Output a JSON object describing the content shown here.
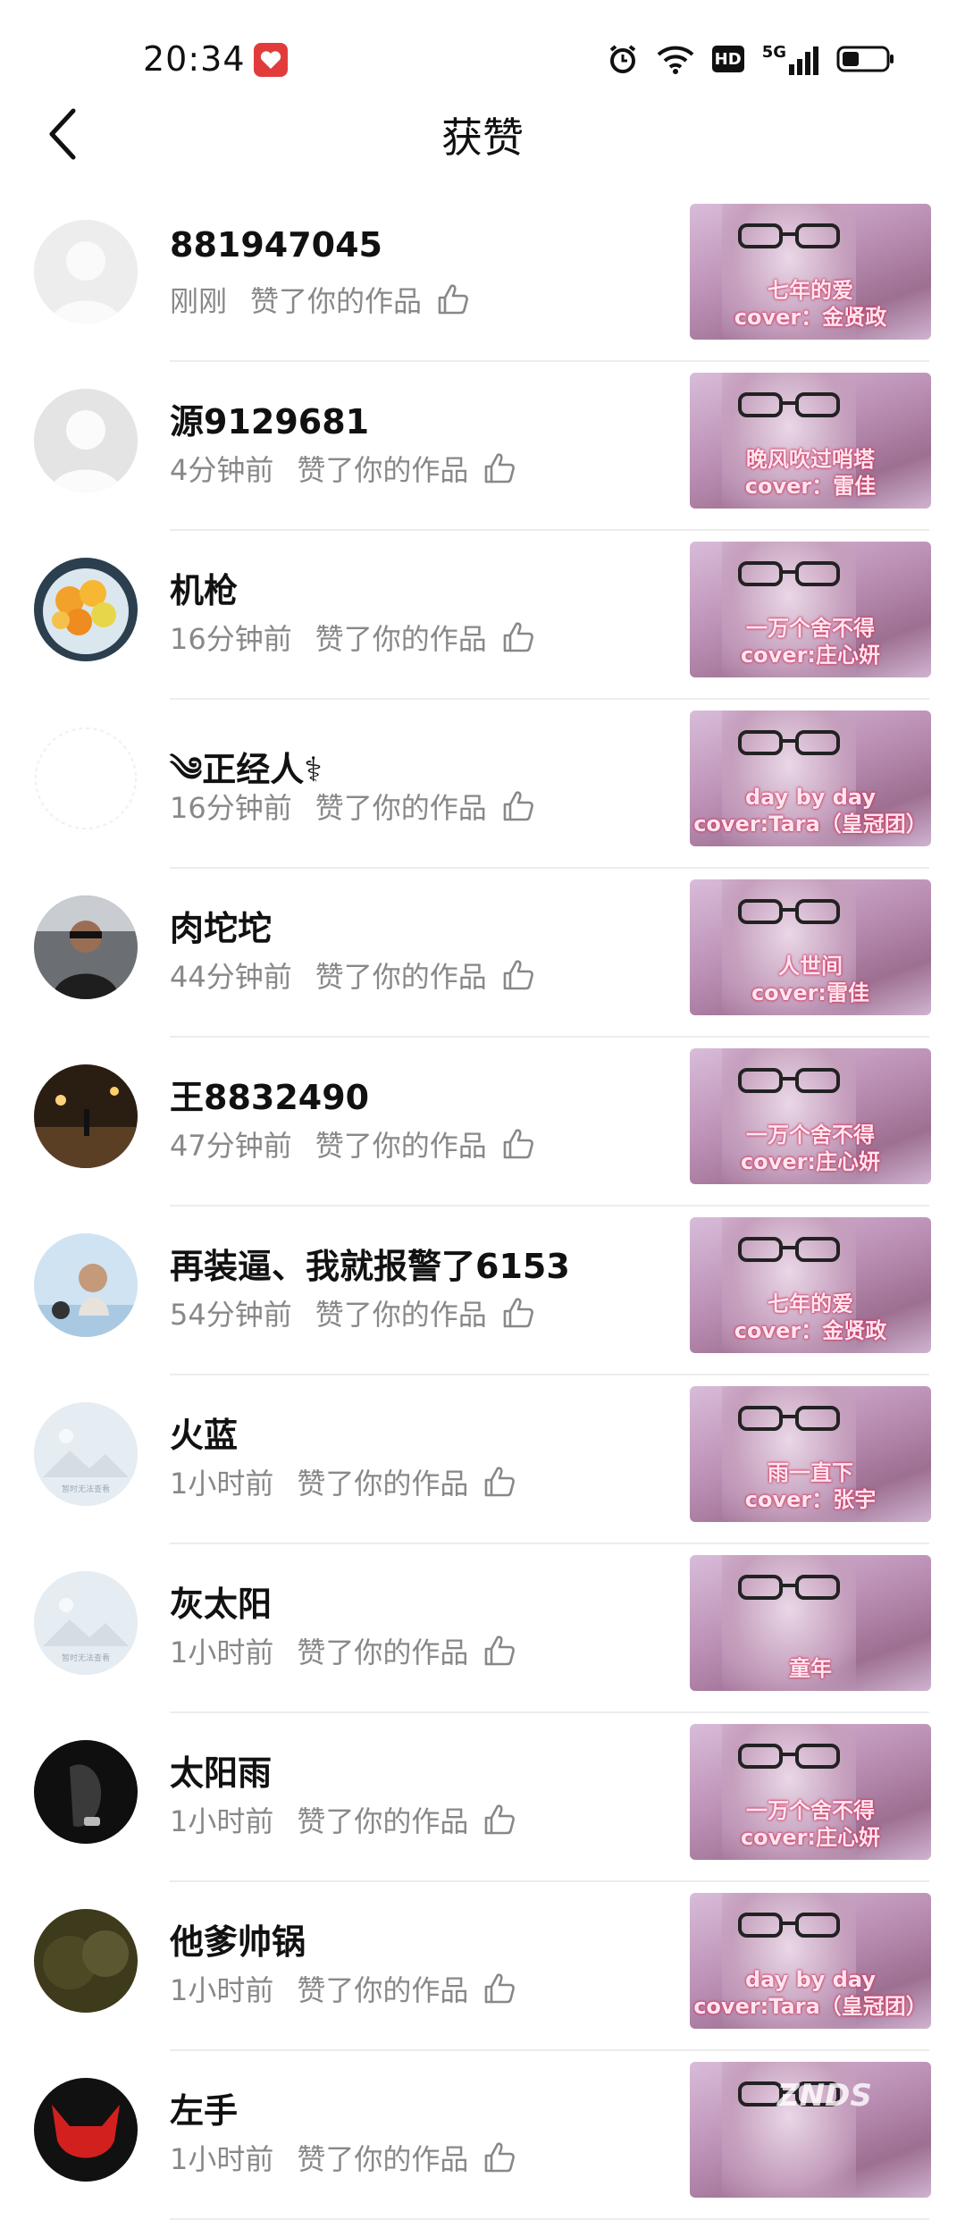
{
  "status_bar": {
    "time": "20:34",
    "icons": [
      "alarm-icon",
      "wifi-icon",
      "hd-icon",
      "5g-signal-icon",
      "battery-icon"
    ],
    "hd_label": "HD",
    "network_label": "5G"
  },
  "header": {
    "title": "获赞",
    "back_icon": "chevron-left-icon"
  },
  "items": [
    {
      "name": "881947045",
      "time": "刚刚",
      "action": "赞了你的作品",
      "caption": [
        "七年的爱",
        "cover：金贤政"
      ],
      "avatar": "default-light"
    },
    {
      "name": "源9129681",
      "time": "4分钟前",
      "action": "赞了你的作品",
      "caption": [
        "晚风吹过哨塔",
        "cover：雷佳"
      ],
      "avatar": "default-grey"
    },
    {
      "name": "机枪",
      "time": "16分钟前",
      "action": "赞了你的作品",
      "caption": [
        "一万个舍不得",
        "cover:庄心妍"
      ],
      "avatar": "fruit"
    },
    {
      "name": "༄正经人⚕",
      "time": "16分钟前",
      "action": "赞了你的作品",
      "caption": [
        "day by day",
        "cover:Tara（皇冠团）"
      ],
      "avatar": "blank"
    },
    {
      "name": "肉坨坨",
      "time": "44分钟前",
      "action": "赞了你的作品",
      "caption": [
        "人世间",
        "cover:雷佳"
      ],
      "avatar": "person-car"
    },
    {
      "name": "王8832490",
      "time": "47分钟前",
      "action": "赞了你的作品",
      "caption": [
        "一万个舍不得",
        "cover:庄心妍"
      ],
      "avatar": "night"
    },
    {
      "name": "再装逼、我就报警了6153",
      "time": "54分钟前",
      "action": "赞了你的作品",
      "caption": [
        "七年的爱",
        "cover：金贤政"
      ],
      "avatar": "girl-sky"
    },
    {
      "name": "火蓝",
      "time": "1小时前",
      "action": "赞了你的作品",
      "caption": [
        "雨一直下",
        "cover：张宇"
      ],
      "avatar": "unavailable"
    },
    {
      "name": "灰太阳",
      "time": "1小时前",
      "action": "赞了你的作品",
      "caption": [
        "童年",
        ""
      ],
      "avatar": "unavailable"
    },
    {
      "name": "太阳雨",
      "time": "1小时前",
      "action": "赞了你的作品",
      "caption": [
        "一万个舍不得",
        "cover:庄心妍"
      ],
      "avatar": "dark-hand"
    },
    {
      "name": "他爹帅锅",
      "time": "1小时前",
      "action": "赞了你的作品",
      "caption": [
        "day by day",
        "cover:Tara（皇冠团）"
      ],
      "avatar": "grass"
    },
    {
      "name": "左手",
      "time": "1小时前",
      "action": "赞了你的作品",
      "caption": [
        "",
        ""
      ],
      "avatar": "red-devil"
    }
  ],
  "watermark": "ZNDS",
  "avatar_placeholder_text": "暂时无法查看",
  "colors": {
    "text_primary": "#111111",
    "text_secondary": "#888888",
    "divider": "#ececec",
    "caption": "#d12b5a"
  }
}
